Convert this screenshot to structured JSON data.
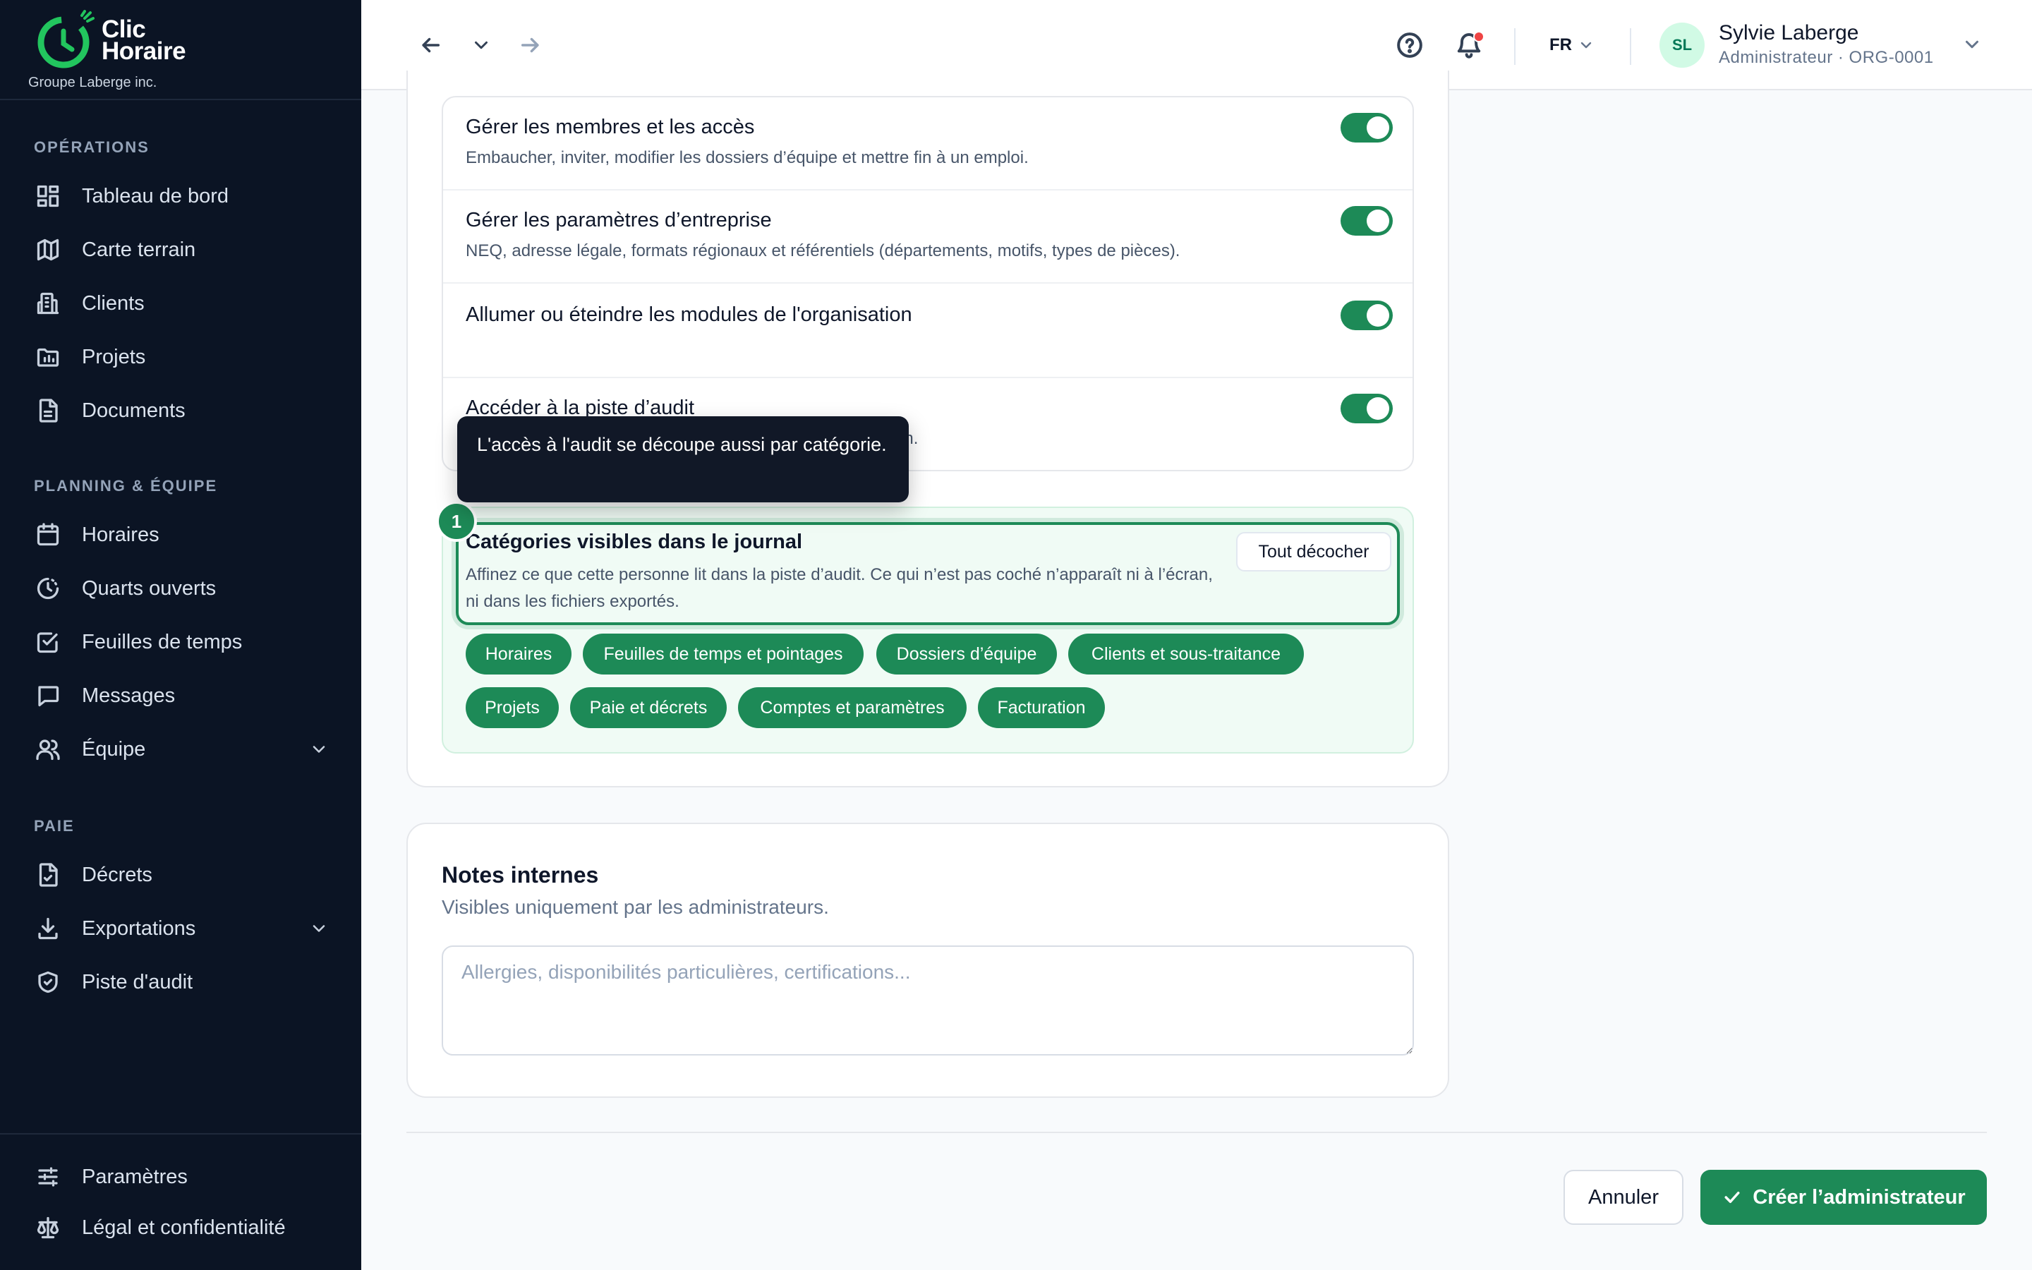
{
  "sidebar": {
    "brand_line1": "Clic",
    "brand_line2": "Horaire",
    "org": "Groupe Laberge inc.",
    "sections": {
      "operations": "OPÉRATIONS",
      "planning": "PLANNING & ÉQUIPE",
      "paie": "PAIE"
    },
    "items": {
      "dashboard": "Tableau de bord",
      "map": "Carte terrain",
      "clients": "Clients",
      "projects": "Projets",
      "documents": "Documents",
      "schedules": "Horaires",
      "open_shifts": "Quarts ouverts",
      "timesheets": "Feuilles de temps",
      "messages": "Messages",
      "team": "Équipe",
      "decrees": "Décrets",
      "exports": "Exportations",
      "audit": "Piste d'audit",
      "settings": "Paramètres",
      "legal": "Légal et confidentialité"
    }
  },
  "topbar": {
    "language": "FR",
    "user_initials": "SL",
    "user_name": "Sylvie Laberge",
    "user_role": "Administrateur · ORG-0001"
  },
  "permissions": [
    {
      "title": "Gérer les membres et les accès",
      "desc": "Embaucher, inviter, modifier les dossiers d’équipe et mettre fin à un emploi.",
      "enabled": true
    },
    {
      "title": "Gérer les paramètres d’entreprise",
      "desc": "NEQ, adresse légale, formats régionaux et référentiels (départements, motifs, types de pièces).",
      "enabled": true
    },
    {
      "title": "Allumer ou éteindre les modules de l'organisation",
      "desc": "",
      "enabled": true
    },
    {
      "title": "Accéder à la piste d’audit",
      "desc": "on.",
      "enabled": true
    }
  ],
  "tooltip": {
    "text": "L'accès à l'audit se découpe aussi par catégorie."
  },
  "audit": {
    "step": "1",
    "title": "Catégories visibles dans le journal",
    "desc": "Affinez ce que cette personne lit dans la piste d’audit. Ce qui n’est pas coché n’apparaît ni à l’écran, ni dans les fichiers exportés.",
    "uncheck_all": "Tout décocher",
    "chips": [
      "Horaires",
      "Feuilles de temps et pointages",
      "Dossiers d’équipe",
      "Clients et sous-traitance",
      "Projets",
      "Paie et décrets",
      "Comptes et paramètres",
      "Facturation"
    ]
  },
  "notes": {
    "title": "Notes internes",
    "subtitle": "Visibles uniquement par les administrateurs.",
    "placeholder": "Allergies, disponibilités particulières, certifications..."
  },
  "footer": {
    "cancel": "Annuler",
    "create": "Créer l’administrateur"
  },
  "colors": {
    "accent": "#1d8a57",
    "sidebar_bg": "#0b1424"
  }
}
